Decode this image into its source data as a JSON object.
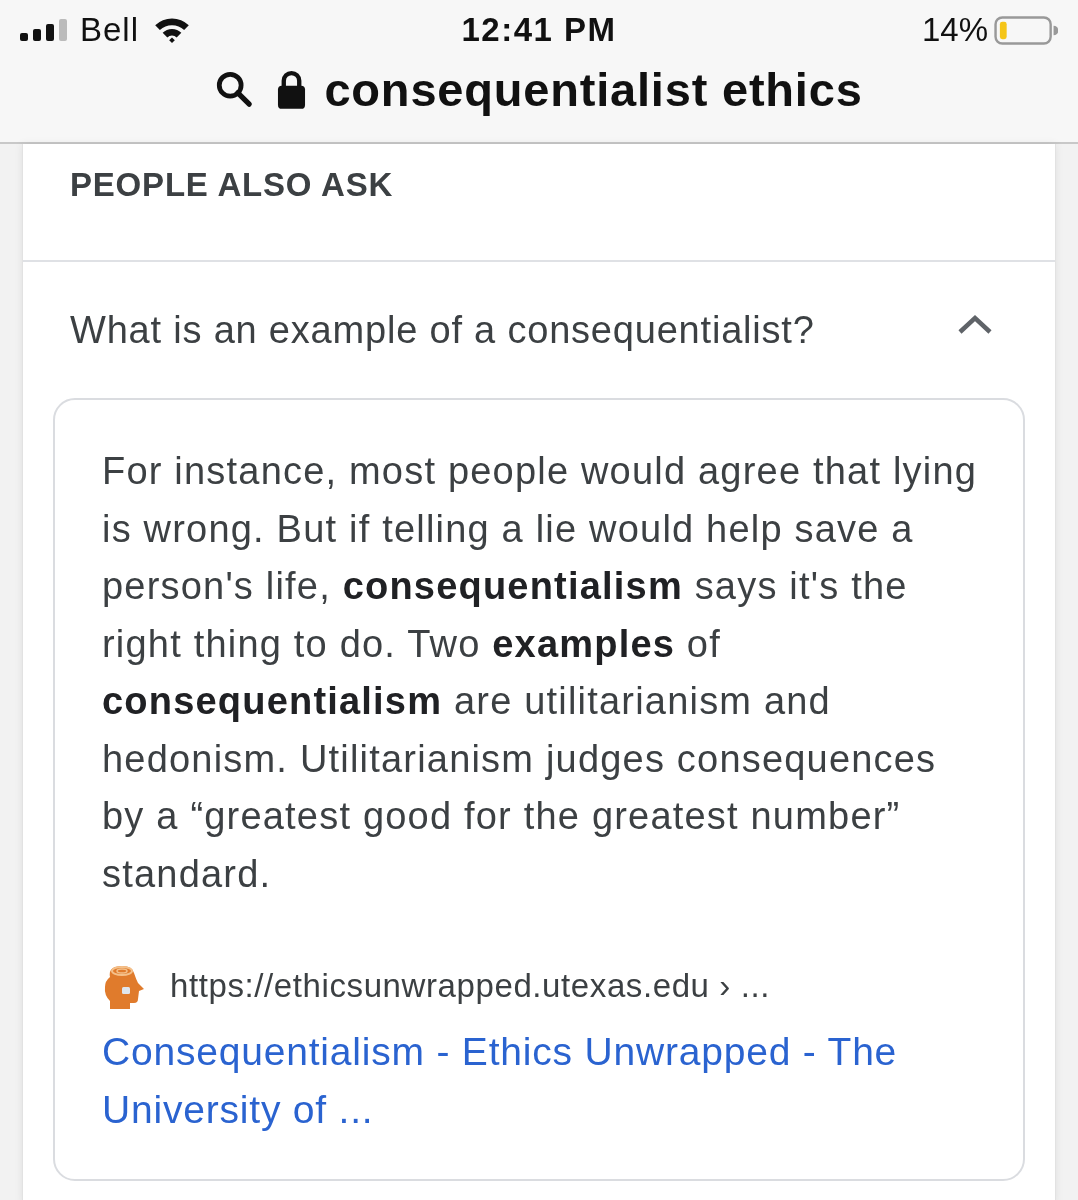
{
  "status_bar": {
    "carrier": "Bell",
    "time": "12:41 PM",
    "battery": "14%"
  },
  "address_bar": {
    "query": "consequentialist ethics"
  },
  "people_also_ask": {
    "heading": "PEOPLE ALSO ASK",
    "questions": [
      {
        "question": "What is an example of a consequentialist?",
        "expanded": true,
        "answer": "For instance, most people would agree that lying is wrong. But if telling a lie would help save a person's life, **consequentialism** says it's the right thing to do. Two **examples** of **consequentialism** are utilitarianism and hedonism. Utilitarianism judges consequences by a “greatest good for the greatest number” standard.",
        "source_url": "https://ethicsunwrapped.utexas.edu › ...",
        "link_title": "Consequentialism - Ethics Unwrapped - The University of ..."
      }
    ]
  }
}
